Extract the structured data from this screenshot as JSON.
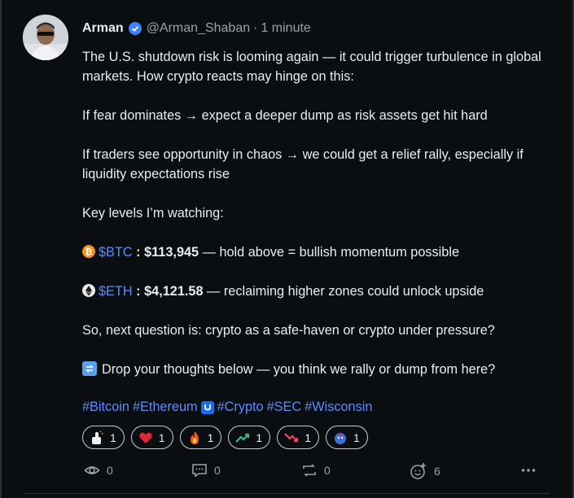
{
  "post": {
    "author": "Arman",
    "handle": "@Arman_Shaban",
    "separator": "·",
    "time": "1 minute",
    "lines": [
      "The U.S. shutdown risk is looming again — it could trigger turbulence in global markets. How crypto reacts may hinge on this:",
      "If fear dominates → expect a deeper dump as risk assets get hit hard",
      "If traders see opportunity in chaos → we could get a relief rally, especially if liquidity expectations rise",
      "Key levels I’m watching:",
      "So, next question is: crypto as a safe-haven or crypto under pressure?",
      "Drop your thoughts below — you think we rally or dump from here?"
    ],
    "levels": [
      {
        "ticker": "$BTC",
        "sep": " : ",
        "price": "$113,945",
        "note": " — hold above = bullish momentum possible"
      },
      {
        "ticker": "$ETH",
        "sep": " : ",
        "price": "$4,121.58",
        "note": " — reclaiming higher zones could unlock upside"
      }
    ],
    "hashtags": [
      "#Bitcoin",
      "#Ethereum",
      "#Crypto",
      "#SEC",
      "#Wisconsin"
    ]
  },
  "reactions": [
    {
      "icon": "thumbs-up-icon",
      "count": "1"
    },
    {
      "icon": "heart-icon",
      "count": "1"
    },
    {
      "icon": "fire-icon",
      "count": "1"
    },
    {
      "icon": "trend-up-icon",
      "count": "1"
    },
    {
      "icon": "trend-down-icon",
      "count": "1"
    },
    {
      "icon": "rocket-icon",
      "count": "1"
    }
  ],
  "actions": {
    "views": "0",
    "comments": "0",
    "reposts": "0",
    "reactions_total": "6"
  },
  "colors": {
    "background": "#0b0e11",
    "text": "#eaecef",
    "muted": "#9aa1ab",
    "link": "#5d8bff",
    "btc": "#f7931a",
    "verified": "#3b82f6"
  }
}
